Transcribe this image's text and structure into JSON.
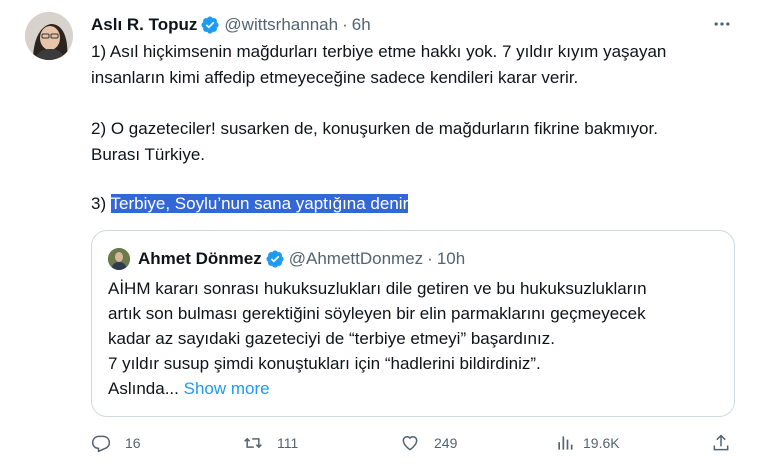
{
  "tweet": {
    "author_name": "Aslı R. Topuz",
    "handle": "@wittsrhannah",
    "separator": "·",
    "time": "6h",
    "lines": [
      "1) Asıl hiçkimsenin mağdurları terbiye etme hakkı yok. 7 yıldır kıyım yaşayan",
      "insanların kimi affedip etmeyeceğine sadece kendileri karar verir.",
      "2) O gazeteciler! susarken de, konuşurken de mağdurların fikrine bakmıyor.",
      "Burası Türkiye."
    ],
    "line3_prefix": "3) ",
    "line3_highlight": "Terbiye, Soylu’nun sana yaptığına denir"
  },
  "quote": {
    "author_name": "Ahmet Dönmez",
    "handle": "@AhmettDonmez",
    "separator": "·",
    "time": "10h",
    "lines": [
      "AİHM kararı sonrası hukuksuzlukları dile getiren ve bu hukuksuzlukların",
      "artık son bulması gerektiğini söyleyen bir elin parmaklarını geçmeyecek",
      "kadar az sayıdaki gazeteciyi de “terbiye etmeyi” başardınız.",
      "7 yıldır susup şimdi konuştukları için “hadlerini bildirdiniz”."
    ],
    "truncated": "Aslında...",
    "show_more": "Show more"
  },
  "actions": {
    "replies": "16",
    "retweets": "111",
    "likes": "249",
    "views": "19.6K"
  },
  "colors": {
    "text": "#0f1419",
    "secondary": "#536471",
    "accent": "#1d9bf0",
    "highlight": "#3367d6",
    "border": "#cfd9de"
  },
  "icons": [
    "verified-badge-icon",
    "more-options-icon",
    "reply-icon",
    "retweet-icon",
    "like-icon",
    "views-icon",
    "share-icon"
  ]
}
